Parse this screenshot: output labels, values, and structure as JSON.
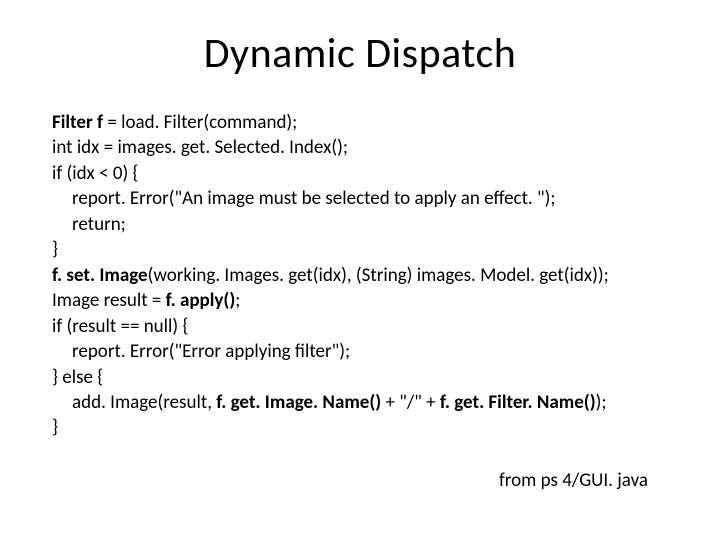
{
  "title": "Dynamic Dispatch",
  "code": {
    "l1a": "Filter f",
    "l1b": " = load. Filter(command);",
    "l2": "int idx = images. get. Selected. Index();",
    "l3": "if (idx < 0) {",
    "l4": "report. Error(\"An image must be selected to apply an effect. \");",
    "l5": "return;",
    "l6": "}",
    "l7a": "f. set. Image",
    "l7b": "(working. Images. get(idx), (String) images. Model. get(idx));",
    "l8a": "Image result = ",
    "l8b": "f. apply()",
    "l8c": ";",
    "l9": "if (result == null) {",
    "l10": "report. Error(\"Error applying filter\");",
    "l11": "} else {",
    "l12a": "add. Image(result, ",
    "l12b": "f. get. Image. Name()",
    "l12c": " + \"/\" + ",
    "l12d": "f. get. Filter. Name()",
    "l12e": ");",
    "l13": "}"
  },
  "attribution": "from ps 4/GUI. java"
}
